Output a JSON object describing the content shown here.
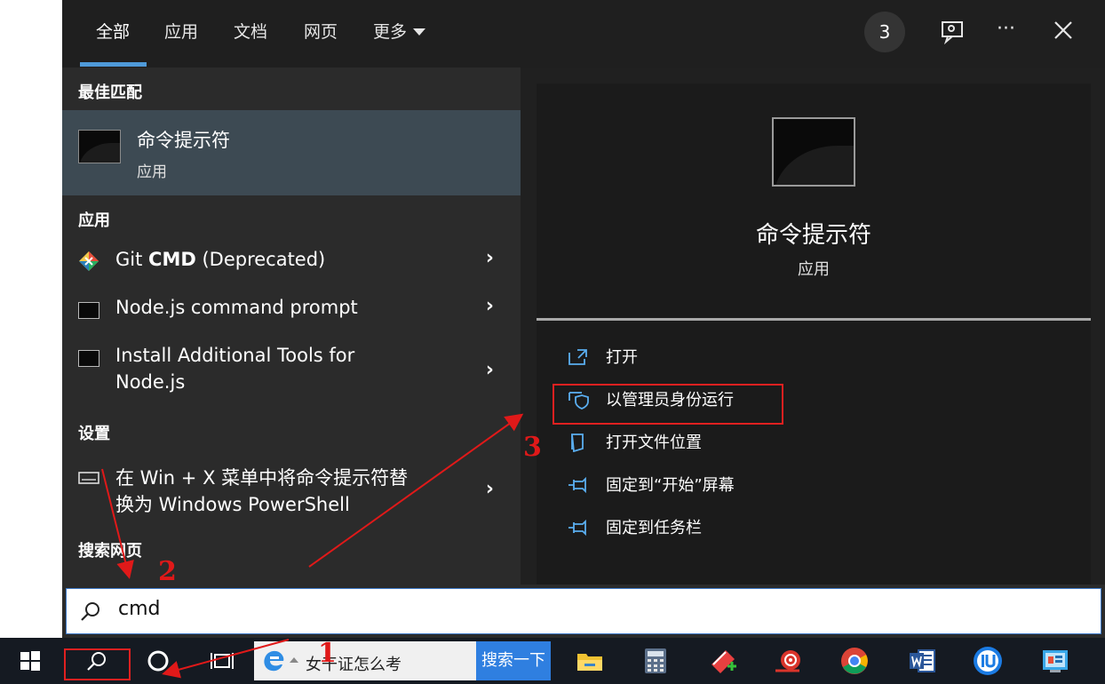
{
  "tabs": [
    {
      "label": "全部"
    },
    {
      "label": "应用"
    },
    {
      "label": "文档"
    },
    {
      "label": "网页"
    },
    {
      "label": "更多"
    }
  ],
  "badge_count": "3",
  "left": {
    "best_match_header": "最佳匹配",
    "best_match": {
      "title": "命令提示符",
      "subtitle": "应用"
    },
    "apps_header": "应用",
    "apps": [
      {
        "title_prefix": "Git ",
        "title_bold": "CMD",
        "title_suffix": " (Deprecated)"
      },
      {
        "title": "Node.js command prompt"
      },
      {
        "title_line1": "Install Additional Tools for",
        "title_line2": "Node.js"
      }
    ],
    "settings_header": "设置",
    "setting": {
      "line1": "在 Win + X 菜单中将命令提示符替",
      "line2": "换为 Windows PowerShell"
    },
    "web_header": "搜索网页"
  },
  "detail": {
    "title": "命令提示符",
    "subtitle": "应用",
    "actions": [
      {
        "label": "打开",
        "icon": "open-window-icon"
      },
      {
        "label": "以管理员身份运行",
        "icon": "shield-icon"
      },
      {
        "label": "打开文件位置",
        "icon": "file-location-icon"
      },
      {
        "label": "固定到“开始”屏幕",
        "icon": "pin-icon"
      },
      {
        "label": "固定到任务栏",
        "icon": "pin-icon"
      }
    ]
  },
  "search": {
    "query": "cmd",
    "icon": "search-icon"
  },
  "taskbar": {
    "news_text": "女干证怎么考",
    "news_button": "搜索一下",
    "apps": [
      "file-explorer-icon",
      "calculator-icon",
      "notes-icon",
      "snail-icon",
      "chrome-icon",
      "word-icon",
      "iu-icon",
      "control-panel-icon"
    ]
  },
  "annotations": {
    "n1": "1",
    "n2": "2",
    "n3": "3"
  },
  "colors": {
    "accent": "#4f9ad9",
    "highlight": "#3d4a53",
    "annotation": "#e01919"
  }
}
